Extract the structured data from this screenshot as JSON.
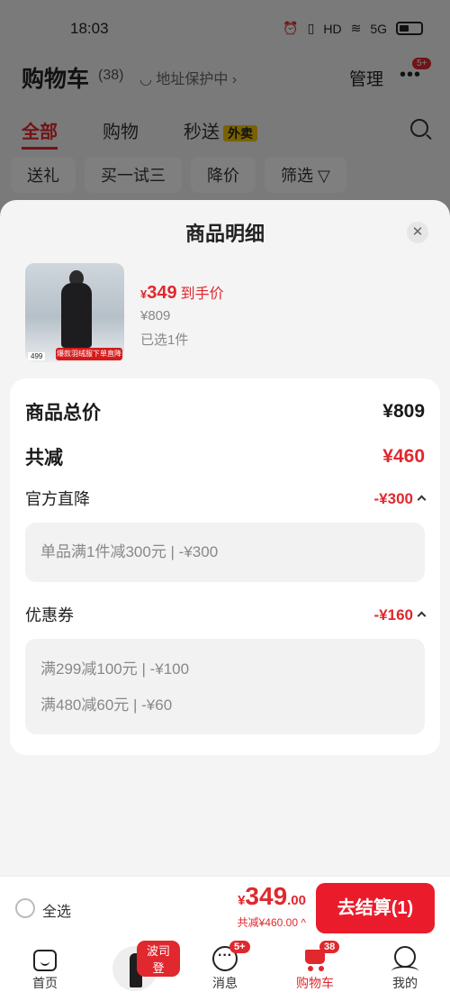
{
  "status_bar": {
    "time": "18:03",
    "icons": [
      "alarm-icon",
      "vibrate-icon",
      "hd-icon",
      "wifi-icon",
      "signal-icon",
      "battery-icon"
    ],
    "net_label": "5G"
  },
  "header": {
    "title": "购物车",
    "count": "(38)",
    "address": "地址保护中",
    "manage": "管理",
    "more_badge": "5+"
  },
  "tabs": [
    {
      "label": "全部",
      "active": true
    },
    {
      "label": "购物"
    },
    {
      "label": "秒送",
      "tag": "外卖"
    }
  ],
  "chips": [
    "送礼",
    "买一试三",
    "降价",
    "筛选"
  ],
  "sheet": {
    "title": "商品明细",
    "product": {
      "price_symbol": "¥",
      "price": "349",
      "price_label": "到手价",
      "original": "¥809",
      "selected": "已选1件",
      "image_price": "499",
      "image_banner": "爆款羽绒服下单直降"
    },
    "summary": {
      "total_label": "商品总价",
      "total_value": "¥809",
      "reduce_label": "共减",
      "reduce_value": "¥460"
    },
    "official": {
      "label": "官方直降",
      "value": "-¥300",
      "details": [
        "单品满1件减300元 | -¥300"
      ]
    },
    "coupon": {
      "label": "优惠券",
      "value": "-¥160",
      "details": [
        "满299减100元 | -¥100",
        "满480减60元 | -¥60"
      ]
    }
  },
  "bottom_bar": {
    "select_all": "全选",
    "price_symbol": "¥",
    "price_int": "349",
    "price_dec": ".00",
    "saved": "共减¥460.00",
    "checkout": "去结算(1)"
  },
  "tabbar": {
    "items": [
      {
        "label": "首页",
        "icon": "home-icon"
      },
      {
        "label": "",
        "icon": "ad-thumbnail",
        "tag": "波司登"
      },
      {
        "label": "消息",
        "icon": "message-icon",
        "badge": "5+"
      },
      {
        "label": "购物车",
        "icon": "cart-icon",
        "badge": "38",
        "active": true
      },
      {
        "label": "我的",
        "icon": "profile-icon"
      }
    ]
  },
  "colors": {
    "accent": "#e0282e",
    "checkout": "#ea1c2c",
    "takeout_tag": "#f5c400"
  }
}
